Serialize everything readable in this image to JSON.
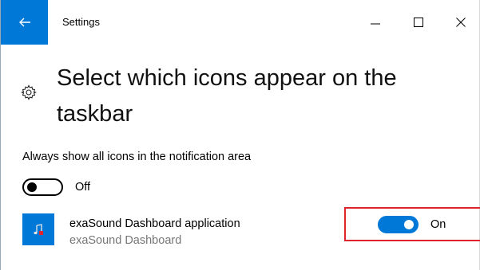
{
  "window": {
    "title": "Settings",
    "accent_color": "#0078d7",
    "controls": {
      "minimize": "minimize-icon",
      "maximize": "maximize-icon",
      "close": "close-icon"
    }
  },
  "header": {
    "back_icon": "back-arrow-icon",
    "page_icon": "gear-icon",
    "title": "Select which icons appear on the taskbar"
  },
  "always_show": {
    "label": "Always show all icons in the notification area",
    "state": "Off",
    "enabled": false
  },
  "apps": [
    {
      "name": "exaSound Dashboard application",
      "publisher": "exaSound Dashboard",
      "icon": "music-note-icon",
      "state": "On",
      "enabled": true,
      "highlighted": true,
      "highlight_color": "#e0242c"
    }
  ]
}
